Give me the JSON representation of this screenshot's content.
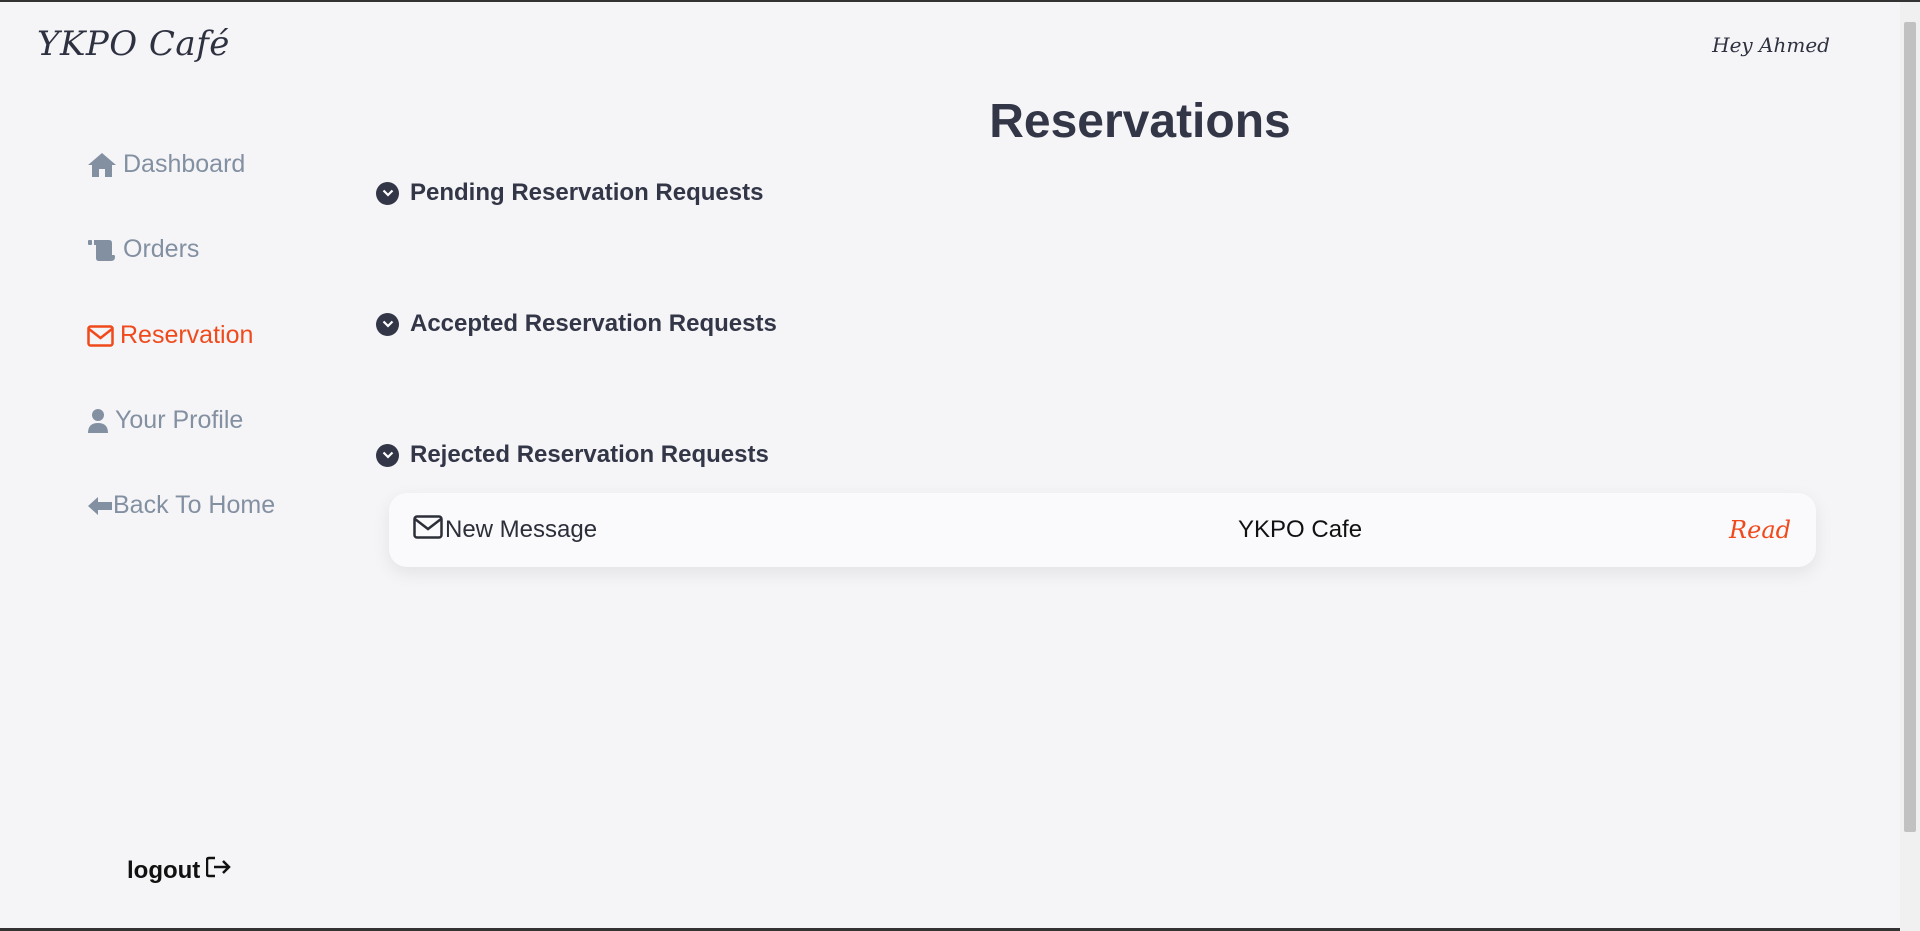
{
  "header": {
    "brand": "YKPO Café",
    "greeting": "Hey Ahmed"
  },
  "sidebar": {
    "items": [
      {
        "label": "Dashboard",
        "icon": "home-icon"
      },
      {
        "label": "Orders",
        "icon": "scroll-icon"
      },
      {
        "label": "Reservation",
        "icon": "envelope-icon",
        "active": true
      },
      {
        "label": "Your Profile",
        "icon": "user-icon"
      },
      {
        "label": "Back To Home",
        "icon": "arrow-left-icon"
      }
    ],
    "logout_label": "logout"
  },
  "main": {
    "title": "Reservations",
    "sections": [
      {
        "label": "Pending Reservation Requests"
      },
      {
        "label": "Accepted Reservation Requests"
      },
      {
        "label": "Rejected Reservation Requests"
      }
    ],
    "message": {
      "subject": "New Message",
      "sender": "YKPO Cafe",
      "action": "Read"
    }
  },
  "colors": {
    "accent": "#f04a1c",
    "nav_inactive": "#8390a2",
    "heading": "#323647",
    "background": "#f5f5f7"
  }
}
